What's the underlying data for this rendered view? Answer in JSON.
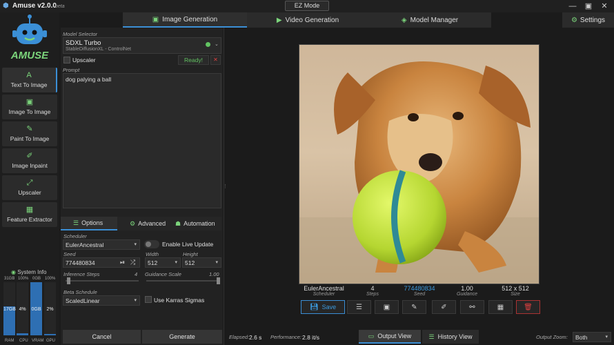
{
  "app": {
    "title": "Amuse v2.0.0",
    "beta": "beta",
    "ez_mode": "EZ Mode",
    "logo_text": "AMUSE"
  },
  "tabs": [
    {
      "label": "Image Generation",
      "icon": "image-icon"
    },
    {
      "label": "Video Generation",
      "icon": "video-icon"
    },
    {
      "label": "Model Manager",
      "icon": "layers-icon"
    }
  ],
  "settings_label": "Settings",
  "nav": [
    {
      "label": "Text To Image",
      "icon": "text-icon"
    },
    {
      "label": "Image To Image",
      "icon": "image-icon"
    },
    {
      "label": "Paint To Image",
      "icon": "brush-icon"
    },
    {
      "label": "Image Inpaint",
      "icon": "inpaint-icon"
    },
    {
      "label": "Upscaler",
      "icon": "expand-icon"
    },
    {
      "label": "Feature Extractor",
      "icon": "extract-icon"
    }
  ],
  "sysinfo": {
    "title": "System Info",
    "caps": [
      "31GB",
      "100%",
      "0GB",
      "100%"
    ],
    "bars": [
      {
        "name": "RAM",
        "value": "17GB",
        "fill": 0.55
      },
      {
        "name": "CPU",
        "value": "4%",
        "fill": 0.04
      },
      {
        "name": "VRAM",
        "value": "0GB",
        "fill": 1.0
      },
      {
        "name": "GPU",
        "value": "2%",
        "fill": 0.02
      }
    ]
  },
  "model": {
    "selector_label": "Model Selector",
    "name": "SDXL Turbo",
    "sub": "StableDiffusionXL - ControlNet",
    "upscaler_label": "Upscaler",
    "ready": "Ready!",
    "close": "✕"
  },
  "prompt": {
    "label": "Prompt",
    "value": "dog palying a ball"
  },
  "subtabs": [
    {
      "label": "Options",
      "icon": "sliders-icon"
    },
    {
      "label": "Advanced",
      "icon": "gears-icon"
    },
    {
      "label": "Automation",
      "icon": "robot-icon"
    }
  ],
  "options": {
    "scheduler_label": "Scheduler",
    "scheduler": "EulerAncestral",
    "live_update": "Enable Live Update",
    "seed_label": "Seed",
    "seed": "774480834",
    "width_label": "Width",
    "width": "512",
    "height_label": "Height",
    "height": "512",
    "steps_label": "Inference Steps",
    "steps": "4",
    "steps_fraction": 0.04,
    "guidance_label": "Guidance Scale",
    "guidance": "1.00",
    "guidance_fraction": 1.0,
    "beta_label": "Beta Schedule",
    "beta": "ScaledLinear",
    "karras": "Use Karras Sigmas"
  },
  "actions": {
    "cancel": "Cancel",
    "generate": "Generate"
  },
  "result": {
    "meta": [
      {
        "value": "EulerAncestral",
        "label": "Scheduler"
      },
      {
        "value": "4",
        "label": "Steps"
      },
      {
        "value": "774480834",
        "label": "Seed",
        "accent": "#3b9be0"
      },
      {
        "value": "1.00",
        "label": "Guidance"
      },
      {
        "value": "512 x 512",
        "label": "Size"
      }
    ],
    "save_label": "Save"
  },
  "status": {
    "elapsed_label": "Elapsed:",
    "elapsed": "2.6 s",
    "perf_label": "Performance:",
    "perf": "2.8 it/s",
    "output_view": "Output View",
    "history_view": "History View",
    "zoom_label": "Output Zoom:",
    "zoom": "Both"
  },
  "colors": {
    "accent": "#3b8fd6",
    "ready": "#62c462",
    "close": "#e04040",
    "nav_icon": "#7bd47b"
  }
}
